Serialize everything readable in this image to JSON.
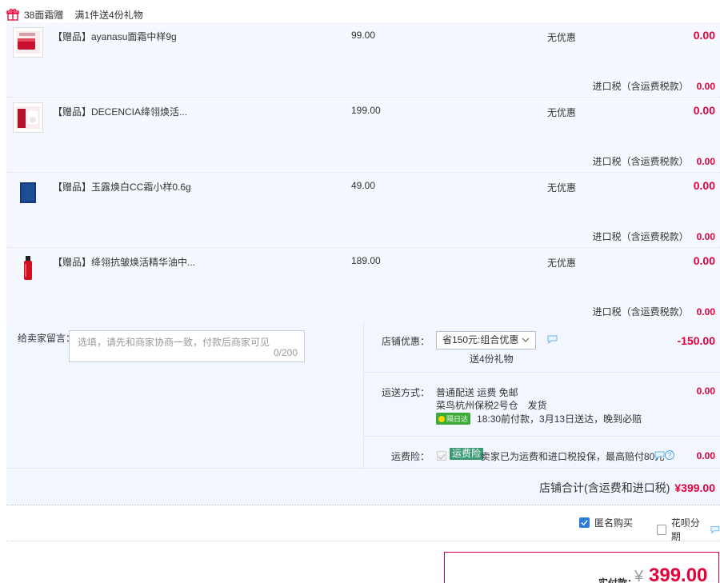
{
  "promo": {
    "name": "38面霜赠",
    "desc": "满1件送4份礼物"
  },
  "items": [
    {
      "title": "【赠品】ayanasu面霜中样9g",
      "price": "99.00",
      "promo": "无优惠",
      "total": "0.00",
      "tax_label": "进口税（含运费税款）",
      "tax_value": "0.00",
      "thumb": "red-jar"
    },
    {
      "title": "【赠品】DECENCIA绛翎焕活...",
      "price": "199.00",
      "promo": "无优惠",
      "total": "0.00",
      "tax_label": "进口税（含运费税款）",
      "tax_value": "0.00",
      "thumb": "red-tube"
    },
    {
      "title": "【赠品】玉露焕白CC霜小样0.6g",
      "price": "49.00",
      "promo": "无优惠",
      "total": "0.00",
      "tax_label": "进口税（含运费税款）",
      "tax_value": "0.00",
      "thumb": "blue-sachet"
    },
    {
      "title": "【赠品】绛翎抗皱焕活精华油中...",
      "price": "189.00",
      "promo": "无优惠",
      "total": "0.00",
      "tax_label": "进口税（含运费税款）",
      "tax_value": "0.00",
      "thumb": "red-bottle"
    }
  ],
  "memo": {
    "label": "给卖家留言：",
    "placeholder": "选填，请先和商家协商一致，付款后商家可见",
    "counter": "0/200"
  },
  "shop_discount": {
    "label": "店铺优惠：",
    "selected": "省150元:组合优惠",
    "note": "送4份礼物",
    "value": "-150.00"
  },
  "shipping": {
    "label": "运送方式：",
    "line1": "普通配送 运费 免邮",
    "line2": "菜鸟杭州保税2号仓　发货",
    "badge": "隔日达",
    "eta": "18:30前付款，3月13日送达，晚到必赔",
    "value": "0.00"
  },
  "insurance": {
    "label": "运费险：",
    "badge": "运费险",
    "text": "卖家已为运费和进口税投保，最高赔付80元",
    "help": "?",
    "value": "0.00"
  },
  "shop_total": {
    "label": "店铺合计(含运费和进口税)",
    "value": "¥399.00"
  },
  "options": {
    "anonymous": "匿名购买",
    "huabei": "花呗分期"
  },
  "payment": {
    "label": "实付款：",
    "currency": "¥",
    "amount": "399.00"
  },
  "colors": {
    "price_red": "#e4003a",
    "panel_blue": "#f2f7ff",
    "accent_blue": "#2b7cd8",
    "badge_green": "#3a9a72"
  }
}
